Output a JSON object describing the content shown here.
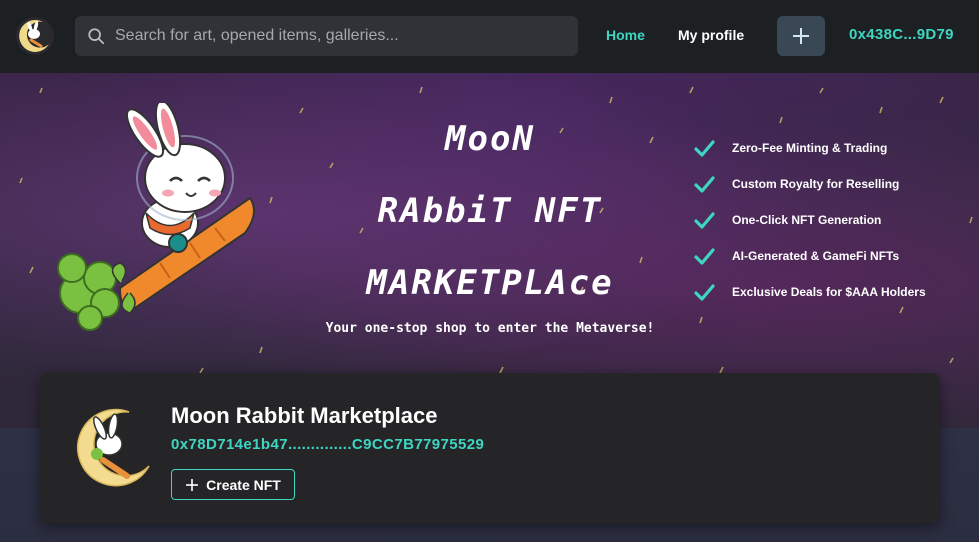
{
  "header": {
    "search_placeholder": "Search for art, opened items, galleries...",
    "nav": {
      "home": "Home",
      "profile": "My profile"
    },
    "wallet": "0x438C...9D79",
    "accent_color": "#3ed6c1"
  },
  "hero": {
    "title_lines": [
      "MooN",
      "RAbbiT NFT",
      "MARKETPLAce"
    ],
    "subtitle": "Your one-stop shop to enter the Metaverse!",
    "features": [
      "Zero-Fee Minting & Trading",
      "Custom Royalty for Reselling",
      "One-Click NFT Generation",
      "AI-Generated & GameFi NFTs",
      "Exclusive Deals for $AAA Holders"
    ]
  },
  "profile_card": {
    "name": "Moon Rabbit Marketplace",
    "address": "0x78D714e1b47..............C9CC7B77975529",
    "create_label": "Create NFT"
  },
  "icons": {
    "logo": "moon-rabbit-logo-icon",
    "search": "search-icon",
    "add": "plus-icon",
    "check": "check-icon"
  }
}
